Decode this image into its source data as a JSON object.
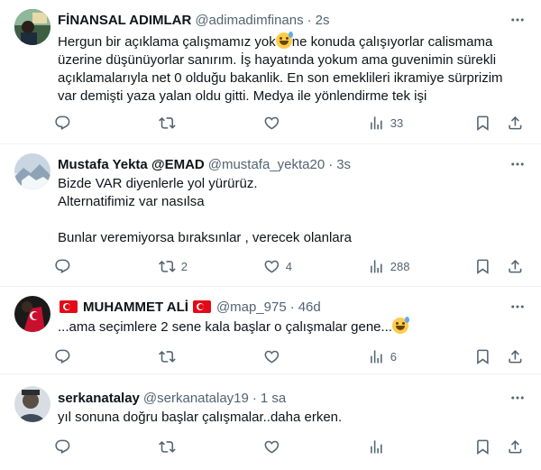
{
  "tweets": [
    {
      "name": "FİNANSAL ADIMLAR",
      "handle": "@adimadimfinans",
      "time": "2s",
      "lines": [
        "Hergun bir açıklama çalışmamız yok",
        "ne konuda çalışıyorlar calismama",
        "üzerine düşünüyorlar sanırım. İş hayatında yokum ama guvenimin sürekli",
        "açıklamalarıyla net 0 olduğu bakanlik. En son emeklileri ikramiye sürprizim",
        "var demişti yaza yalan oldu gitti. Medya ile yönlendirme tek işi"
      ],
      "replies": "",
      "retweets": "",
      "likes": "",
      "views": "33",
      "avatar_color": "#5a7a5f"
    },
    {
      "name": "Mustafa Yekta @EMAD",
      "handle": "@mustafa_yekta20",
      "time": "3s",
      "lines": [
        "Bizde VAR diyenlerle yol yürürüz.",
        "Alternatifimiz var nasılsa",
        "",
        "Bunlar veremiyorsa bıraksınlar , verecek olanlara"
      ],
      "replies": "",
      "retweets": "2",
      "likes": "4",
      "views": "288",
      "avatar_color": "#b8c7d6"
    },
    {
      "name": "MUHAMMET ALİ",
      "handle": "@map_975",
      "time": "46d",
      "lines": [
        "...ama seçimlere 2 sene kala başlar o çalışmalar gene..."
      ],
      "replies": "",
      "retweets": "",
      "likes": "",
      "views": "6",
      "avatar_color": "#2b2b2b"
    },
    {
      "name": "serkanatalay",
      "handle": "@serkanatalay19",
      "time": "1 sa",
      "lines": [
        "yıl sonuna doğru başlar çalışmalar..daha erken."
      ],
      "replies": "",
      "retweets": "",
      "likes": "",
      "views": "",
      "avatar_color": "#7d8a96"
    }
  ],
  "separator": "·",
  "icons": {
    "reply": "reply-icon",
    "retweet": "retweet-icon",
    "like": "heart-icon",
    "views": "views-icon",
    "bookmark": "bookmark-icon",
    "share": "share-icon",
    "more": "more-icon"
  },
  "colors": {
    "text": "#0f1419",
    "muted": "#536471",
    "divider": "#eff3f4"
  }
}
